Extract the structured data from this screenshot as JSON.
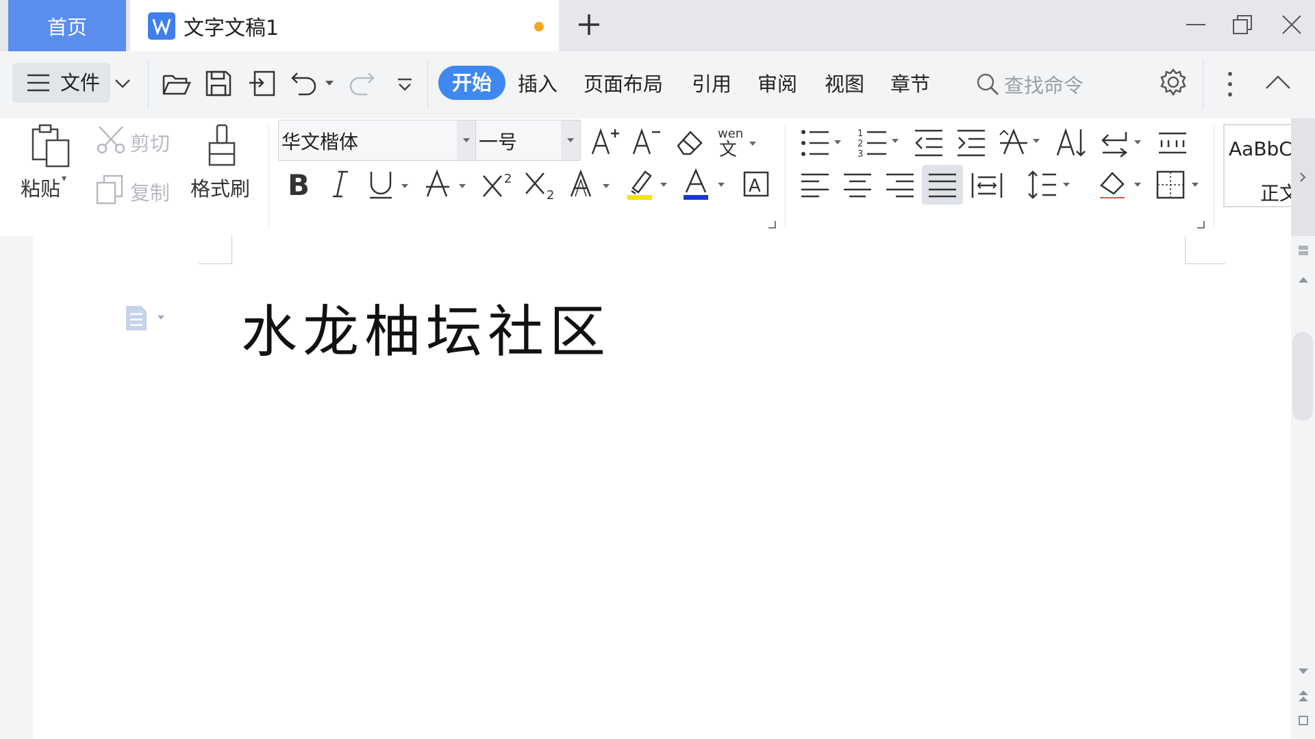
{
  "titlebar": {
    "home_tab": "首页",
    "doc_tab": "文字文稿1"
  },
  "menubar": {
    "file": "文件",
    "tabs": [
      "开始",
      "插入",
      "页面布局",
      "引用",
      "审阅",
      "视图",
      "章节"
    ],
    "search_placeholder": "查找命令"
  },
  "ribbon": {
    "paste": "粘贴",
    "cut": "剪切",
    "copy": "复制",
    "format_painter": "格式刷",
    "font_name": "华文楷体",
    "font_size": "一号",
    "style_preview": "AaBbC",
    "style_name": "正文"
  },
  "document": {
    "title": "水龙柚坛社区"
  },
  "colors": {
    "accent": "#3f88f0",
    "home_tab": "#5b8def",
    "modified_dot": "#f5a623",
    "highlight": "#f6e30f",
    "font_color": "#1a39d6"
  }
}
